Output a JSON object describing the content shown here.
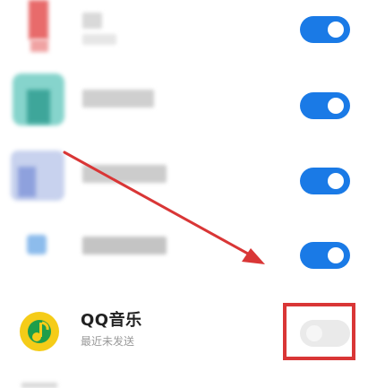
{
  "apps": [
    {
      "name": "",
      "status": "",
      "enabled": true
    },
    {
      "name": "",
      "status": "",
      "enabled": true
    },
    {
      "name": "",
      "status": "",
      "enabled": true
    },
    {
      "name": "",
      "status": "",
      "enabled": true
    },
    {
      "name": "QQ音乐",
      "status": "最近未发送",
      "enabled": false
    }
  ],
  "colors": {
    "toggle_on": "#1a7ae6",
    "toggle_off": "#eaeaea",
    "highlight": "#d93636",
    "arrow": "#d93636",
    "qq_music_icon": "#f5cc18"
  },
  "icons": {
    "qq_music": "qq-music-icon"
  }
}
